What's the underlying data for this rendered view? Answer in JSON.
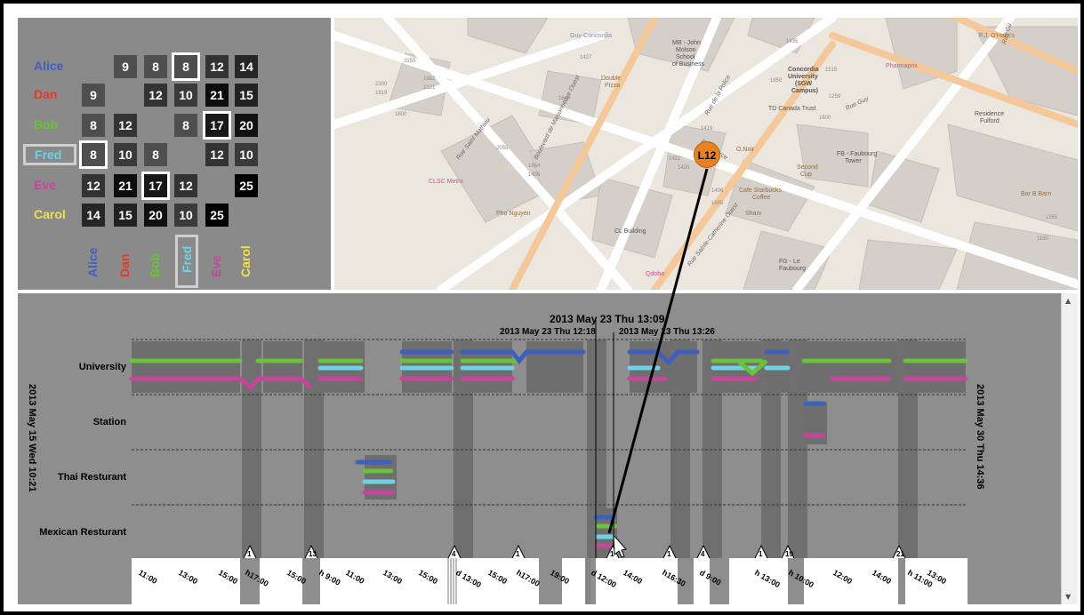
{
  "matrix": {
    "rows": [
      {
        "name": "Alice",
        "color": "#3f5fbf",
        "cells": [
          null,
          "9",
          "8",
          "8",
          "12",
          "14"
        ]
      },
      {
        "name": "Dan",
        "color": "#e23a2a",
        "cells": [
          "9",
          null,
          "12",
          "10",
          "21",
          "15"
        ]
      },
      {
        "name": "Bob",
        "color": "#6ac13a",
        "cells": [
          "8",
          "12",
          null,
          "8",
          "17",
          "20"
        ]
      },
      {
        "name": "Fred",
        "color": "#6fd3e6",
        "cells": [
          "8",
          "10",
          "8",
          null,
          "12",
          "10"
        ]
      },
      {
        "name": "Eve",
        "color": "#c6459a",
        "cells": [
          "12",
          "21",
          "17",
          "12",
          null,
          "25"
        ]
      },
      {
        "name": "Carol",
        "color": "#f0e04a",
        "cells": [
          "14",
          "15",
          "20",
          "10",
          "25",
          null
        ]
      }
    ],
    "columns": [
      {
        "name": "Alice",
        "color": "#3f5fbf"
      },
      {
        "name": "Dan",
        "color": "#e23a2a"
      },
      {
        "name": "Bob",
        "color": "#6ac13a"
      },
      {
        "name": "Fred",
        "color": "#6fd3e6"
      },
      {
        "name": "Eve",
        "color": "#c6459a"
      },
      {
        "name": "Carol",
        "color": "#f0e04a"
      }
    ],
    "selected_person": "Fred"
  },
  "map": {
    "streets": [
      "Rue Saint Mathieu",
      "Boulevard de Maisonneuve Ouest",
      "Rue Pierce",
      "Rue de la Police",
      "Rue Guy",
      "Rue Sainte-Catherine Ouest",
      "Rue Gu"
    ],
    "pois": [
      "Guy-Concordia",
      "MB - John Molson School of Business",
      "Double Pizza",
      "Concordia University (SGW Campus)",
      "TD Canada Trust",
      "P.J. O'Hara's",
      "Pharmaprix",
      "Residence Fulford",
      "O.Noir",
      "Second Cup",
      "FB - Faubourg Tower",
      "Cafe Starbucks Coffee",
      "Sharx",
      "Bar B Barn",
      "Pho Nguyen",
      "CLSC Metro",
      "CL Building",
      "FG - Le Faubourg",
      "Qdoba"
    ],
    "numbers": [
      "2255",
      "2300",
      "1819",
      "1682",
      "2121",
      "1800",
      "1427",
      "1640",
      "1435",
      "1850",
      "1515",
      "1259",
      "1600",
      "1419",
      "1422",
      "1420",
      "1409",
      "2055",
      "1664",
      "1455",
      "1406",
      "1645",
      "1190",
      "1555"
    ],
    "callout_label": "L12"
  },
  "timeline": {
    "places": [
      "University",
      "Station",
      "Thai Resturant",
      "Mexican Resturant"
    ],
    "start_label": "2013 May 15 Wed 10:21",
    "end_label": "2013 May 30 Thu 14:36",
    "cursor_label": "2013 May 23 Thu 13:09",
    "window_start_label": "2013 May 23 Thu 12:18",
    "window_end_label": "2013 May 23 Thu 13:26",
    "time_ticks": [
      "11:00",
      "13:00",
      "15:00",
      "h17:00",
      "15:00",
      "h 9:00",
      "11:00",
      "13:00",
      "15:00",
      "d 13:00",
      "15:00",
      "h17:00",
      "19:00",
      "d 12:00",
      "14:00",
      "h16:30",
      "d 9:00",
      "h 13:00",
      "h 10:00",
      "12:00",
      "14:00",
      "h 11:00",
      "13:00"
    ],
    "gap_labels": [
      "1",
      "13",
      "4",
      "1",
      "1",
      "1",
      "4",
      "1",
      "19",
      "21"
    ]
  }
}
